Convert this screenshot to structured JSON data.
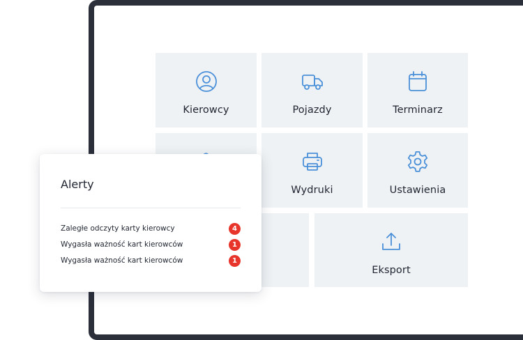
{
  "colors": {
    "accent": "#4a90d9",
    "tile_bg": "#eef2f4",
    "frame": "#2b2f3a",
    "badge": "#e8352b"
  },
  "tiles": [
    {
      "label": "Kierowcy",
      "icon": "user-circle-icon"
    },
    {
      "label": "Pojazdy",
      "icon": "truck-icon"
    },
    {
      "label": "Terminarz",
      "icon": "calendar-icon"
    },
    {
      "label": "",
      "icon": "partial-icon"
    },
    {
      "label": "Wydruki",
      "icon": "printer-icon"
    },
    {
      "label": "Ustawienia",
      "icon": "gear-icon"
    },
    {
      "label": "",
      "icon": ""
    },
    {
      "label": "Eksport",
      "icon": "upload-icon"
    }
  ],
  "alerts": {
    "title": "Alerty",
    "items": [
      {
        "text": "Zaległe odczyty karty kierowcy",
        "count": "4"
      },
      {
        "text": "Wygasła ważność kart kierowców",
        "count": "1"
      },
      {
        "text": "Wygasła ważność kart kierowców",
        "count": "1"
      }
    ]
  }
}
